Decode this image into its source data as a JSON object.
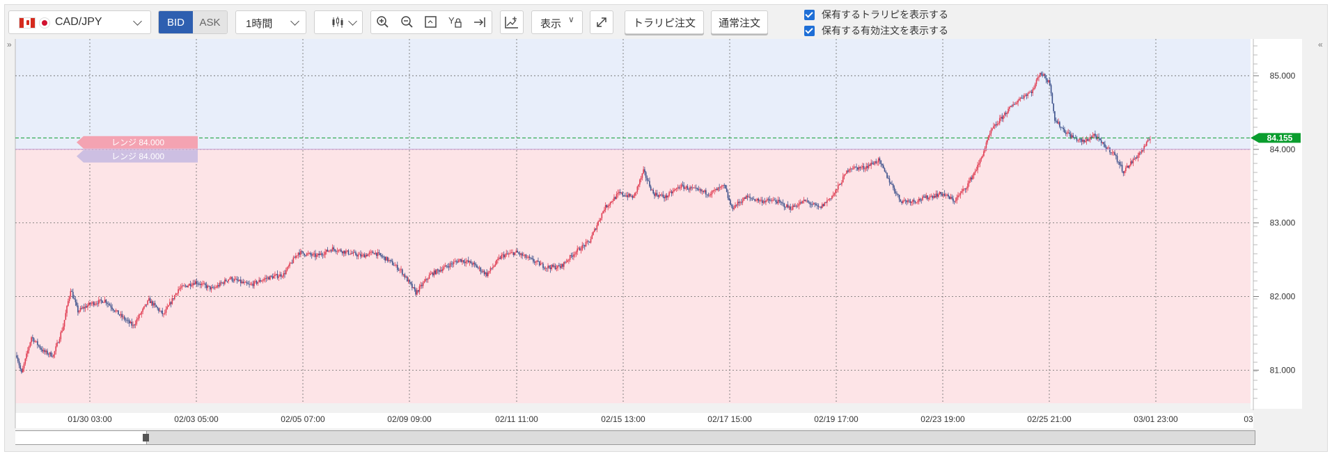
{
  "toolbar": {
    "pair": "CAD/JPY",
    "bid": "BID",
    "ask": "ASK",
    "timeframe": "1時間",
    "display": "表示",
    "trap_order": "トラリピ注文",
    "normal_order": "通常注文",
    "check1": "保有するトラリピを表示する",
    "check2": "保有する有効注文を表示する"
  },
  "colors": {
    "up": "#e0394f",
    "down": "#3a4f8a",
    "buy_zone": "#e8eefa",
    "sell_zone": "#fde4e7",
    "current_price": "#0a9d2e"
  },
  "chart_data": {
    "type": "candlestick",
    "symbol": "CAD/JPY",
    "current_price": "84.155",
    "range_line": 84.0,
    "range_labels": [
      "レンジ 84.000",
      "レンジ 84.000"
    ],
    "ylim": [
      80.55,
      85.5
    ],
    "yticks": [
      "85.000",
      "84.000",
      "83.000",
      "82.000",
      "81.000"
    ],
    "ytick_values": [
      85,
      84,
      83,
      82,
      81
    ],
    "xticks": [
      "01/30 03:00",
      "02/03 05:00",
      "02/05 07:00",
      "02/09 09:00",
      "02/11 11:00",
      "02/15 13:00",
      "02/17 15:00",
      "02/19 17:00",
      "02/23 19:00",
      "02/25 21:00",
      "03/01 23:00",
      "03"
    ],
    "approx_path": [
      [
        0,
        81.2
      ],
      [
        4,
        80.95
      ],
      [
        12,
        81.45
      ],
      [
        22,
        81.25
      ],
      [
        30,
        81.2
      ],
      [
        38,
        81.6
      ],
      [
        44,
        82.1
      ],
      [
        50,
        81.8
      ],
      [
        60,
        81.9
      ],
      [
        72,
        81.95
      ],
      [
        84,
        81.75
      ],
      [
        95,
        81.6
      ],
      [
        108,
        81.95
      ],
      [
        120,
        81.75
      ],
      [
        132,
        82.1
      ],
      [
        146,
        82.2
      ],
      [
        160,
        82.1
      ],
      [
        174,
        82.25
      ],
      [
        190,
        82.15
      ],
      [
        204,
        82.25
      ],
      [
        218,
        82.3
      ],
      [
        230,
        82.6
      ],
      [
        245,
        82.55
      ],
      [
        258,
        82.65
      ],
      [
        270,
        82.6
      ],
      [
        282,
        82.55
      ],
      [
        292,
        82.6
      ],
      [
        303,
        82.5
      ],
      [
        314,
        82.35
      ],
      [
        326,
        82.05
      ],
      [
        338,
        82.3
      ],
      [
        350,
        82.4
      ],
      [
        362,
        82.5
      ],
      [
        372,
        82.45
      ],
      [
        384,
        82.3
      ],
      [
        396,
        82.55
      ],
      [
        408,
        82.6
      ],
      [
        420,
        82.5
      ],
      [
        432,
        82.4
      ],
      [
        444,
        82.4
      ],
      [
        456,
        82.6
      ],
      [
        468,
        82.75
      ],
      [
        480,
        83.2
      ],
      [
        492,
        83.4
      ],
      [
        504,
        83.35
      ],
      [
        512,
        83.7
      ],
      [
        520,
        83.4
      ],
      [
        530,
        83.35
      ],
      [
        542,
        83.5
      ],
      [
        554,
        83.45
      ],
      [
        566,
        83.4
      ],
      [
        578,
        83.5
      ],
      [
        584,
        83.2
      ],
      [
        596,
        83.35
      ],
      [
        608,
        83.3
      ],
      [
        620,
        83.3
      ],
      [
        632,
        83.2
      ],
      [
        644,
        83.3
      ],
      [
        656,
        83.2
      ],
      [
        668,
        83.4
      ],
      [
        680,
        83.75
      ],
      [
        692,
        83.75
      ],
      [
        704,
        83.85
      ],
      [
        712,
        83.6
      ],
      [
        722,
        83.3
      ],
      [
        734,
        83.3
      ],
      [
        744,
        83.35
      ],
      [
        756,
        83.4
      ],
      [
        766,
        83.3
      ],
      [
        776,
        83.5
      ],
      [
        786,
        83.8
      ],
      [
        796,
        84.25
      ],
      [
        808,
        84.5
      ],
      [
        820,
        84.7
      ],
      [
        830,
        84.8
      ],
      [
        836,
        85.05
      ],
      [
        844,
        84.9
      ],
      [
        848,
        84.4
      ],
      [
        856,
        84.25
      ],
      [
        864,
        84.15
      ],
      [
        872,
        84.1
      ],
      [
        880,
        84.2
      ],
      [
        888,
        84.05
      ],
      [
        896,
        83.95
      ],
      [
        904,
        83.7
      ],
      [
        912,
        83.85
      ],
      [
        920,
        84.0
      ],
      [
        926,
        84.15
      ]
    ]
  }
}
